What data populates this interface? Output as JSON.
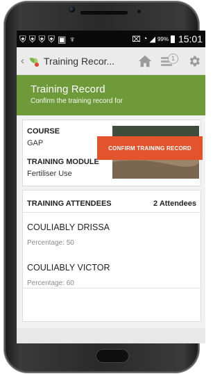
{
  "status_bar": {
    "battery_pct": "99%",
    "time": "15:01"
  },
  "action_bar": {
    "title": "Training Recor...",
    "sync_badge_count": "1"
  },
  "header": {
    "title": "Training Record",
    "subtitle": "Confirm the training record for"
  },
  "course": {
    "course_label": "COURSE",
    "course_value": "GAP",
    "module_label": "TRAINING MODULE",
    "module_value": "Fertiliser Use"
  },
  "attendees": {
    "header": "TRAINING ATTENDEES",
    "count": "2 Attendees",
    "items": [
      {
        "name": "COULIABLY DRISSA",
        "percentage": "Percentage: 50"
      },
      {
        "name": "COULIABLY VICTOR",
        "percentage": "Percentage: 60"
      }
    ]
  },
  "actions": {
    "confirm_label": "CONFIRM TRAINING RECORD"
  },
  "colors": {
    "accent_green": "#6f9a3a",
    "confirm_orange": "#e3542c",
    "status_bar": "#0a0a0a"
  },
  "icons": {
    "status_left": [
      "shield-icon",
      "shield-icon",
      "shield-icon",
      "shield-icon",
      "image-icon",
      "signal-icon"
    ],
    "status_right": [
      "vibrate-icon",
      "wifi-icon",
      "cell-signal-icon",
      "battery-icon"
    ],
    "action_bar": [
      "back-icon",
      "app-leaf-icon",
      "home-icon",
      "sync-icon",
      "gear-icon"
    ]
  }
}
